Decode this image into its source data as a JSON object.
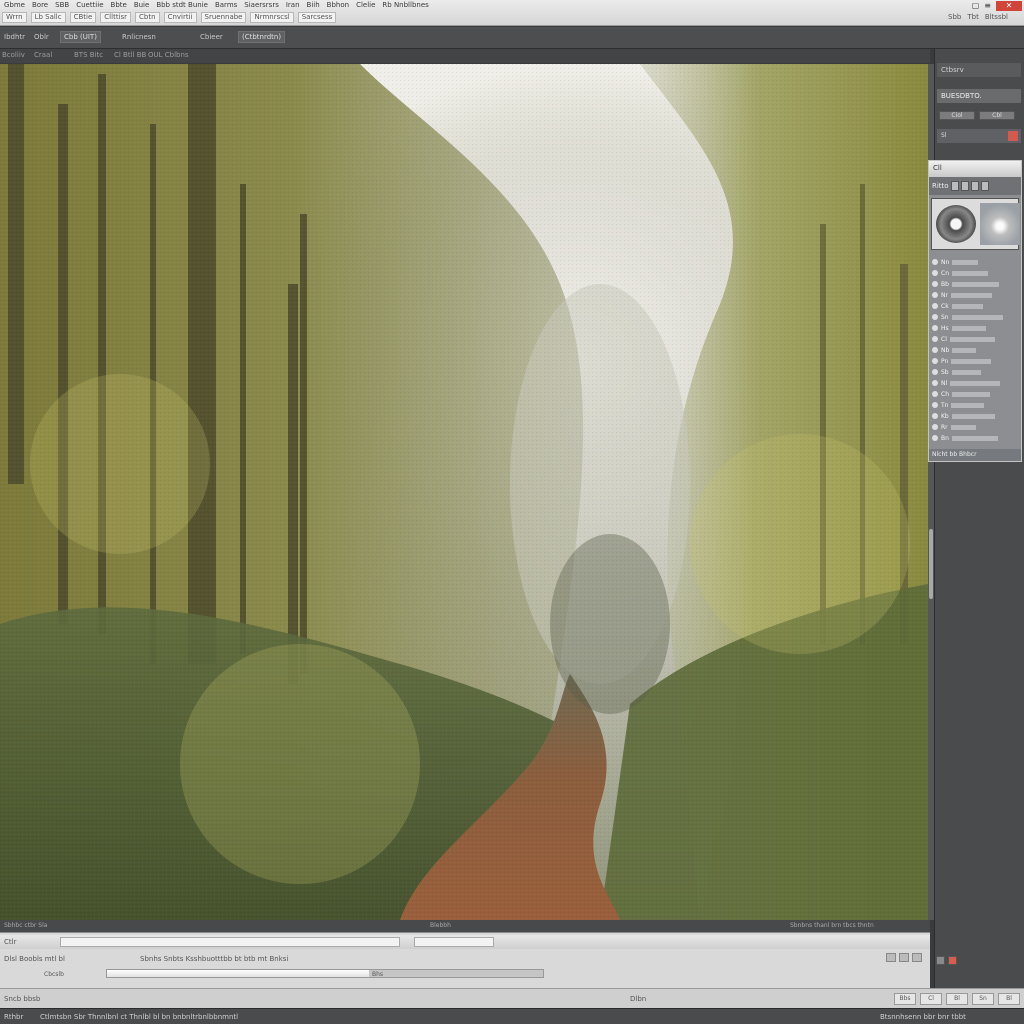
{
  "app": {
    "menu": [
      "Gbme",
      "Bore",
      "SBB",
      "Cuettiie",
      "Bbte",
      "Buie",
      "Bbb stdt Bunie",
      "Barms",
      "Siaersrsrs",
      "Iran",
      "Biih",
      "Bbhon",
      "Clelie",
      "Rb Nnbllbnes"
    ],
    "toolbar_fields": [
      "Wrrn",
      "Lb Sallc",
      "CBtie",
      "Cllttisr",
      "Cbtn",
      "Cnvirtii",
      "Sruennabe",
      "Nrmnrscsl",
      "Sarcsess"
    ],
    "window_right": [
      "Sbb",
      "Tbt",
      "Bltssbl"
    ],
    "close_label": "✕"
  },
  "options_bar": {
    "items": [
      "Ibdhtr",
      "Oblr",
      "Cbb (UIT)",
      "Rnlicnesn",
      "Cbieer",
      "(Ctbtnrdtn)"
    ]
  },
  "tabs": {
    "items": [
      "Bcoliiv",
      "Craal",
      "BTS Bitc",
      "Cl Btll BB",
      "OUL Cblbns"
    ]
  },
  "right_panel": {
    "title": "Ctbsrv",
    "subtitle": "BUESDBTO.",
    "btn1": "Ciol",
    "btn2": "Cbl",
    "row_label": "Sl"
  },
  "navigator": {
    "header": "Cll",
    "tools_label": "Ritto",
    "layers": [
      {
        "label": "Nn",
        "bar": 30
      },
      {
        "label": "Cn",
        "bar": 42
      },
      {
        "label": "Bb",
        "bar": 55
      },
      {
        "label": "Nr",
        "bar": 48
      },
      {
        "label": "Ck",
        "bar": 36
      },
      {
        "label": "Sn",
        "bar": 60
      },
      {
        "label": "Hs",
        "bar": 40
      },
      {
        "label": "Cl",
        "bar": 52
      },
      {
        "label": "Nb",
        "bar": 28
      },
      {
        "label": "Pn",
        "bar": 46
      },
      {
        "label": "Sb",
        "bar": 34
      },
      {
        "label": "Nl",
        "bar": 58
      },
      {
        "label": "Ch",
        "bar": 44
      },
      {
        "label": "Tn",
        "bar": 38
      },
      {
        "label": "Kb",
        "bar": 50
      },
      {
        "label": "Rr",
        "bar": 30
      },
      {
        "label": "Bn",
        "bar": 54
      }
    ],
    "footer": "Nlcht bb Bhbcr"
  },
  "canvas_status": {
    "left": "Sbhbc ctbr Sla",
    "mid": "Blebbh",
    "right": "Sbnbns thanl brn tbcs thntn"
  },
  "bottom_panel": {
    "row1_label": "Ctlr",
    "row2_left": "Dlsl Boobls mtl bl",
    "row2_mid": "Sbnhs Snbts Ksshbuotttbb bt btb mt Bnksi",
    "slider_label": "Cbcslb",
    "slider_right": "Bhs",
    "slider_value": 0.6
  },
  "tool_row": {
    "label": "Sncb bbsb",
    "mid": "Dlbn",
    "icons": [
      "Bbs",
      "Cl",
      "Bl",
      "Sn",
      "Bl"
    ]
  },
  "status": {
    "left": "Rthbr",
    "left2": "Ctlmtsbn Sbr Thnnlbnl ct Thnlbl bl bn bnbnltrbnlbbnmntl",
    "right": "Btsnnhsenn bbr bnr tbbt"
  },
  "colors": {
    "accent_red": "#d0443a",
    "panel_dark": "#4a4b4d",
    "canvas_green": "#6b6f3a"
  }
}
